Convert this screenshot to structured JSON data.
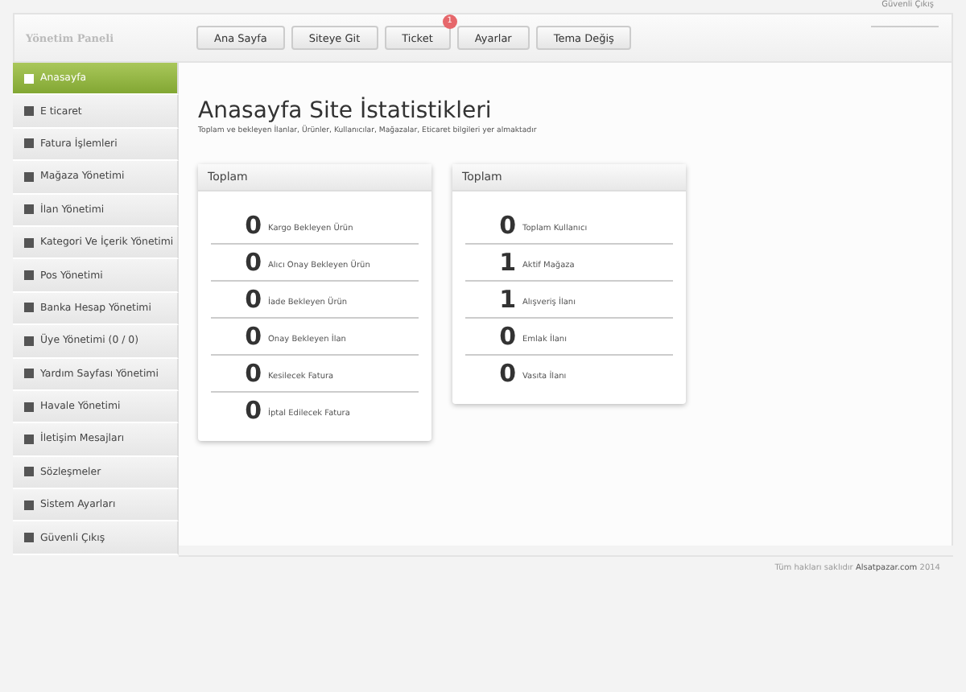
{
  "top_link": "Güvenli Çıkış",
  "logo": "Yönetim Paneli",
  "nav_buttons": [
    {
      "label": "Ana Sayfa"
    },
    {
      "label": "Siteye Git"
    },
    {
      "label": "Ticket",
      "badge": "1"
    },
    {
      "label": "Ayarlar"
    },
    {
      "label": "Tema Değiş"
    }
  ],
  "sidebar": {
    "items": [
      {
        "label": "Anasayfa",
        "selected": true
      },
      {
        "label": "E ticaret",
        "selected": false
      },
      {
        "label": "Fatura İşlemleri",
        "selected": false
      },
      {
        "label": "Mağaza Yönetimi",
        "selected": false
      },
      {
        "label": "İlan Yönetimi",
        "selected": false
      },
      {
        "label": "Kategori Ve İçerik Yönetimi",
        "selected": false
      },
      {
        "label": "Pos Yönetimi",
        "selected": false
      },
      {
        "label": "Banka Hesap Yönetimi",
        "selected": false
      },
      {
        "label": "Üye Yönetimi (0 / 0)",
        "selected": false
      },
      {
        "label": "Yardım Sayfası Yönetimi",
        "selected": false
      },
      {
        "label": "Havale Yönetimi",
        "selected": false
      },
      {
        "label": "İletişim Mesajları",
        "selected": false
      },
      {
        "label": "Sözleşmeler",
        "selected": false
      },
      {
        "label": "Sistem Ayarları",
        "selected": false
      },
      {
        "label": "Güvenli Çıkış",
        "selected": false
      }
    ]
  },
  "page": {
    "title": "Anasayfa Site İstatistikleri",
    "subtitle": "Toplam ve bekleyen İlanlar, Ürünler, Kullanıcılar, Mağazalar, Eticaret bilgileri yer almaktadır"
  },
  "panels": [
    {
      "title": "Toplam",
      "stats": [
        {
          "value": "0",
          "label": "Kargo Bekleyen Ürün"
        },
        {
          "value": "0",
          "label": "Alıcı Onay Bekleyen Ürün"
        },
        {
          "value": "0",
          "label": "İade Bekleyen Ürün"
        },
        {
          "value": "0",
          "label": "Onay Bekleyen İlan"
        },
        {
          "value": "0",
          "label": "Kesilecek Fatura"
        },
        {
          "value": "0",
          "label": "İptal Edilecek Fatura"
        }
      ]
    },
    {
      "title": "Toplam",
      "stats": [
        {
          "value": "0",
          "label": "Toplam Kullanıcı"
        },
        {
          "value": "1",
          "label": "Aktif Mağaza"
        },
        {
          "value": "1",
          "label": "Alışveriş İlanı"
        },
        {
          "value": "0",
          "label": "Emlak İlanı"
        },
        {
          "value": "0",
          "label": "Vasıta İlanı"
        }
      ]
    }
  ],
  "footer": {
    "text": "Tüm hakları saklıdır",
    "link": "Alsatpazar.com",
    "year": "2014"
  }
}
